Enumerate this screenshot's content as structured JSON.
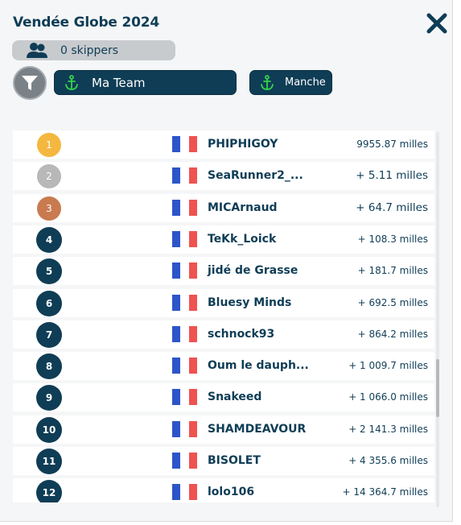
{
  "header": {
    "title": "Vendée Globe 2024",
    "skippers_label": "0 skippers"
  },
  "filters": {
    "team_label": "Ma Team",
    "manche_label": "Manche"
  },
  "colors": {
    "primary": "#0f3d56",
    "gold": "#f4b73f",
    "silver": "#b8b8b8",
    "bronze": "#c97a4f",
    "anchor_green": "#35d24a",
    "flag_blue": "#2d55c8",
    "flag_red": "#ef5350"
  },
  "icons": {
    "close": "close-icon",
    "skippers": "users-icon",
    "filter": "funnel-icon",
    "anchor": "anchor-icon",
    "flag": "france-flag-icon"
  },
  "ranking": [
    {
      "rank": "1",
      "name": "PHIPHIGOY",
      "distance": "9955.87 milles",
      "medal": "gold"
    },
    {
      "rank": "2",
      "name": "SeaRunner2_...",
      "distance": "+ 5.11 milles",
      "medal": "silver"
    },
    {
      "rank": "3",
      "name": "MICArnaud",
      "distance": "+ 64.7 milles",
      "medal": "bronze"
    },
    {
      "rank": "4",
      "name": "TeKk_Loick",
      "distance": "+ 108.3 milles",
      "medal": ""
    },
    {
      "rank": "5",
      "name": "jidé de Grasse",
      "distance": "+ 181.7 milles",
      "medal": ""
    },
    {
      "rank": "6",
      "name": "Bluesy Minds",
      "distance": "+ 692.5 milles",
      "medal": ""
    },
    {
      "rank": "7",
      "name": "schnock93",
      "distance": "+ 864.2 milles",
      "medal": ""
    },
    {
      "rank": "8",
      "name": "Oum le dauph...",
      "distance": "+ 1 009.7 milles",
      "medal": ""
    },
    {
      "rank": "9",
      "name": "Snakeed",
      "distance": "+ 1 066.0 milles",
      "medal": ""
    },
    {
      "rank": "10",
      "name": "SHAMDEAVOUR",
      "distance": "+ 2 141.3 milles",
      "medal": ""
    },
    {
      "rank": "11",
      "name": "BISOLET",
      "distance": "+ 4 355.6 milles",
      "medal": ""
    },
    {
      "rank": "12",
      "name": "lolo106",
      "distance": "+ 14 364.7 milles",
      "medal": ""
    }
  ]
}
